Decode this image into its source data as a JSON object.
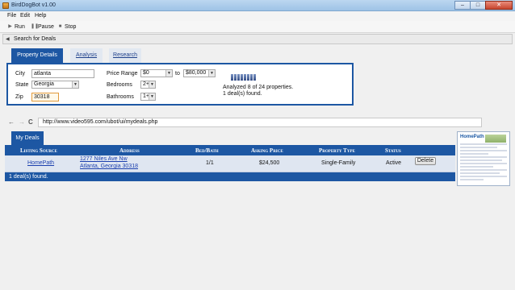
{
  "window": {
    "title": "BirdDogBot v1.00"
  },
  "menu": [
    "File",
    "Edit",
    "Help"
  ],
  "toolbar": {
    "run": "Run",
    "pause": "Pause",
    "stop": "Stop"
  },
  "panel": {
    "title": "Search for Deals"
  },
  "tabs": [
    "Property Details",
    "Analysis",
    "Research"
  ],
  "form": {
    "city_label": "City",
    "city_value": "atlanta",
    "state_label": "State",
    "state_value": "Georgia",
    "zip_label": "Zip",
    "zip_value": "30318",
    "price_label": "Price Range",
    "price_min": "$0",
    "price_to": "to",
    "price_max": "$80,000",
    "bedrooms_label": "Bedrooms",
    "bedrooms_value": "2+",
    "bathrooms_label": "Bathrooms",
    "bathrooms_value": "1+",
    "status_line1": "Analyzed 8 of 24 properties.",
    "status_line2": "1 deal(s) found.",
    "progress_fraction": 0.333
  },
  "browser": {
    "url": "http://www.video595.com/ubot/ui/mydeals.php",
    "back": "←",
    "forward": "→",
    "refresh": "C"
  },
  "deals": {
    "tab": "My Deals",
    "columns": [
      "Listing Source",
      "Address",
      "Bed/Bath",
      "Asking Price",
      "Property Type",
      "Status"
    ],
    "rows": [
      {
        "source": "HomePath",
        "address1": "1277 Niles Ave Nw",
        "address2": "Atlanta, Georgia 30318",
        "bedbath": "1/1",
        "price": "$24,500",
        "type": "Single-Family",
        "status": "Active",
        "action": "Delete"
      }
    ],
    "footer": "1 deal(s) found."
  },
  "thumbnail": {
    "logo": "HomePath"
  }
}
